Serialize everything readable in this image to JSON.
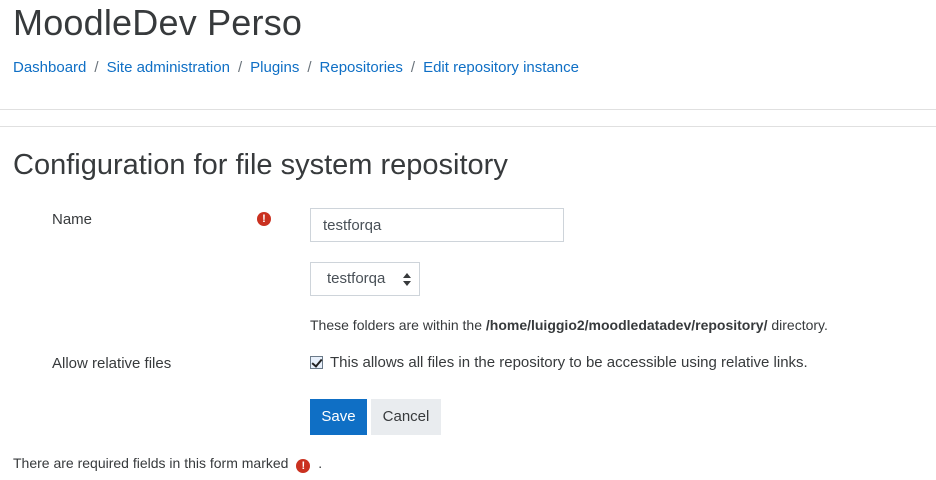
{
  "site": {
    "title": "MoodleDev Perso"
  },
  "breadcrumb": [
    "Dashboard",
    "Site administration",
    "Plugins",
    "Repositories",
    "Edit repository instance"
  ],
  "breadcrumb_separator": "/",
  "page": {
    "heading": "Configuration for file system repository"
  },
  "form": {
    "name_label": "Name",
    "name_value": "testforqa",
    "required_icon": "exclamation-circle-icon",
    "folder_select_value": "testforqa",
    "help_prefix": "These folders are within the ",
    "help_path": "/home/luiggio2/moodledatadev/repository/",
    "help_suffix": " directory.",
    "relative_label": "Allow relative files",
    "relative_checked": true,
    "relative_desc": "This allows all files in the repository to be accessible using relative links.",
    "save_label": "Save",
    "cancel_label": "Cancel",
    "required_note_prefix": "There are required fields in this form marked",
    "required_note_suffix": "."
  },
  "colors": {
    "link": "#0f6fc5",
    "primary": "#0f6fc5",
    "required": "#ca3120"
  }
}
